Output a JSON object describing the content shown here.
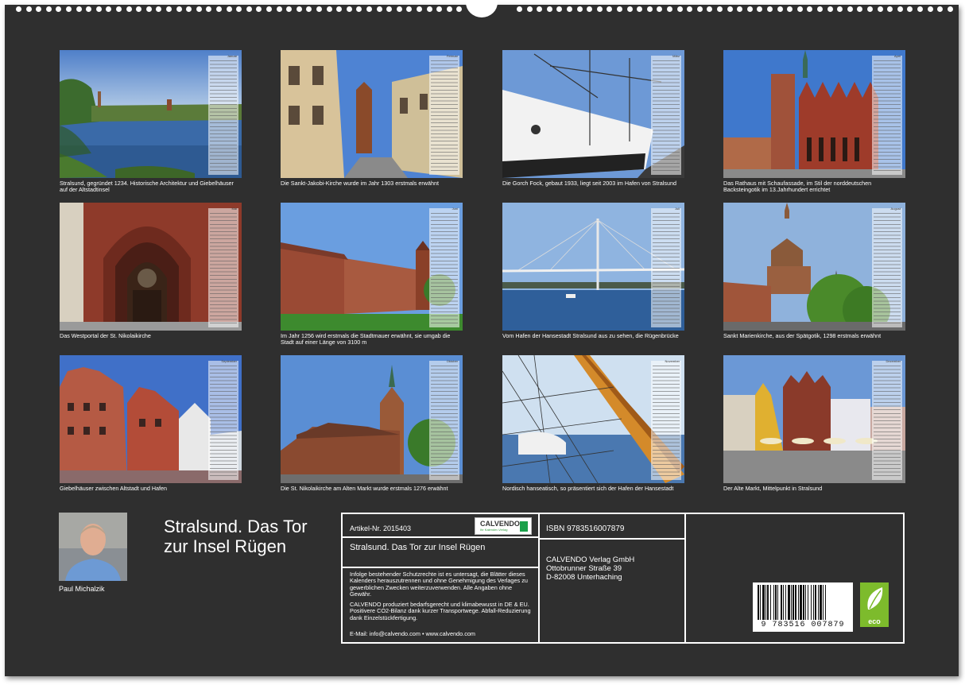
{
  "tiles": [
    {
      "month": "Januar",
      "caption": "Stralsund, gegründet 1234. Historische Architektur und Giebelhäuser auf der Altstadtinsel"
    },
    {
      "month": "Februar",
      "caption": "Die Sankt-Jakobi-Kirche wurde im Jahr 1303 erstmals erwähnt"
    },
    {
      "month": "März",
      "caption": "Die Gorch Fock, gebaut 1933, liegt seit 2003 im Hafen von Stralsund"
    },
    {
      "month": "April",
      "caption": "Das Rathaus mit Schaufassade, im Stil der norddeutschen Backsteingotik im 13.Jahrhundert errichtet"
    },
    {
      "month": "Mai",
      "caption": "Das Westportal der St. Nikolaikirche"
    },
    {
      "month": "Juni",
      "caption": "Im Jahr 1256 wird erstmals die Stadtmauer erwähnt, sie umgab die Stadt auf einer Länge von 3100 m"
    },
    {
      "month": "Juli",
      "caption": "Vom Hafen der Hansestadt Stralsund aus zu sehen, die Rügenbrücke"
    },
    {
      "month": "August",
      "caption": "Sankt Marienkirche, aus der Spätgotik, 1298 erstmals erwähnt"
    },
    {
      "month": "September",
      "caption": "Giebelhäuser zwischen Altstadt und Hafen"
    },
    {
      "month": "Oktober",
      "caption": "Die St. Nikolaikirche am Alten Markt wurde erstmals 1276 erwähnt"
    },
    {
      "month": "November",
      "caption": "Nordisch hanseatisch, so präsentiert sich der Hafen der Hansestadt"
    },
    {
      "month": "Dezember",
      "caption": "Der Alte Markt, Mittelpunkt in Stralsund"
    }
  ],
  "author": {
    "name": "Paul Michalzik"
  },
  "title": "Stralsund. Das Tor zur Insel Rügen",
  "info": {
    "article": "Artikel-Nr. 2015403",
    "logo_brand": "CALVENDO",
    "logo_sub": "Ihr Kalender-Verlag",
    "product_title": "Stralsund. Das Tor zur Insel Rügen",
    "notice1": "Infolge bestehender Schutzrechte ist es untersagt, die Blätter dieses Kalenders herauszutrennen und ohne Genehmigung des Verlages zu gewerblichen Zwecken weiterzuverwenden. Alle Angaben ohne Gewähr.",
    "notice2": "CALVENDO produziert bedarfsgerecht und klimabewusst in DE & EU. Positivere CO2-Bilanz dank kurzer Transportwege. Abfall-Reduzierung dank Einzelstückfertigung.",
    "contact": "E-Mail: info@calvendo.com • www.calvendo.com",
    "isbn": "ISBN 9783516007879",
    "publisher_name": "CALVENDO Verlag GmbH",
    "publisher_street": "Ottobrunner Straße 39",
    "publisher_city": "D-82008 Unterhaching",
    "barcode_number": "9 783516 007879",
    "eco_label": "eco"
  }
}
